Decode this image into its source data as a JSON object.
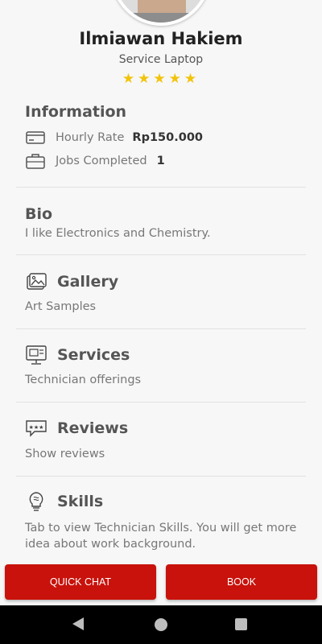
{
  "profile": {
    "name": "Ilmiawan Hakiem",
    "subtitle": "Service Laptop",
    "stars": "★★★★★"
  },
  "information": {
    "title": "Information",
    "hourly_rate_label": "Hourly Rate",
    "hourly_rate_value": "Rp150.000",
    "jobs_label": "Jobs Completed",
    "jobs_value": "1"
  },
  "bio": {
    "title": "Bio",
    "text": "I like Electronics and Chemistry."
  },
  "gallery": {
    "title": "Gallery",
    "desc": "Art Samples"
  },
  "services": {
    "title": "Services",
    "desc": "Technician offerings"
  },
  "reviews": {
    "title": "Reviews",
    "desc": "Show reviews"
  },
  "skills": {
    "title": "Skills",
    "desc": "Tab to view Technician Skills. You will get more idea about work background."
  },
  "actions": {
    "quick_chat": "Quick Chat",
    "book": "Book"
  },
  "colors": {
    "accent": "#c8120b",
    "star": "#f2c30a"
  }
}
